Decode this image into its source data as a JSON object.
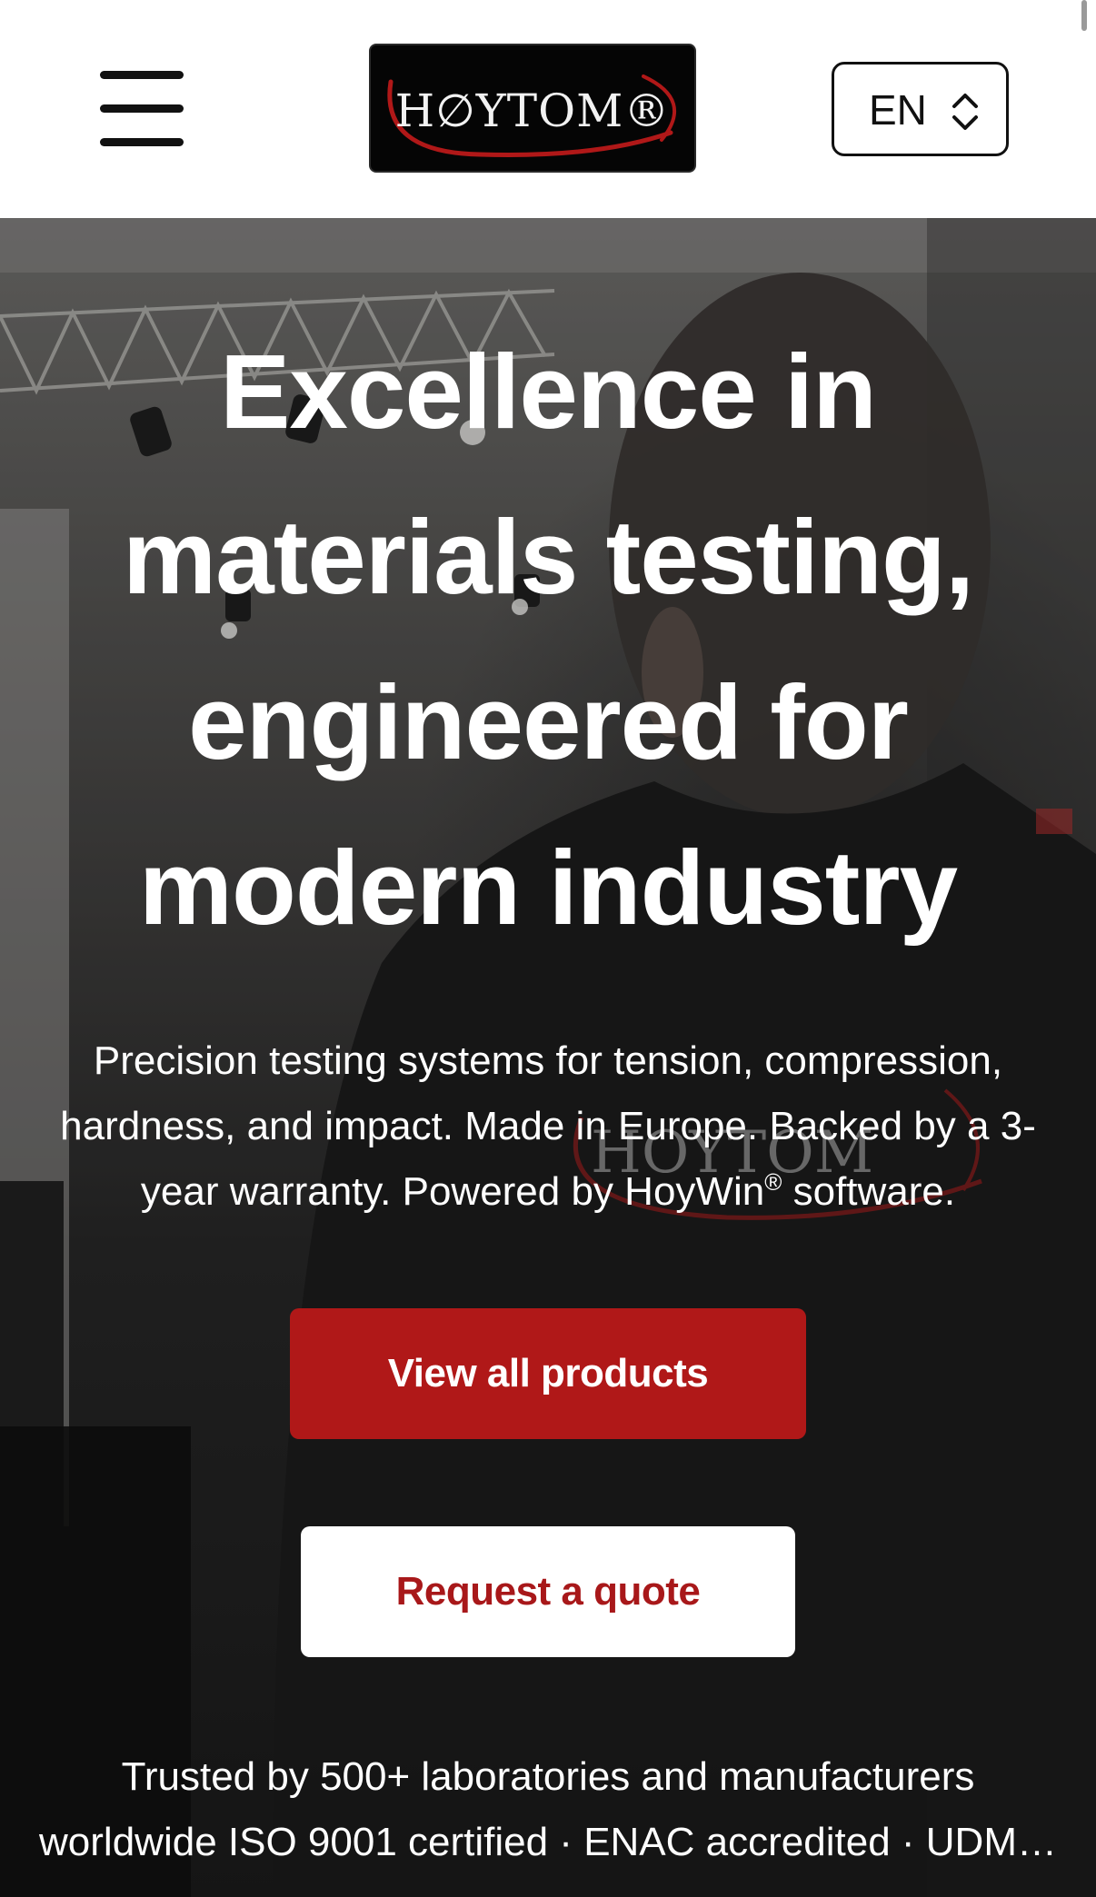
{
  "header": {
    "logo_text": "H∅YTOM®",
    "language": {
      "selected": "EN"
    }
  },
  "hero": {
    "title": "Excellence in materials testing, engineered for modern industry",
    "subtitle_main": "Precision testing systems for tension, compression, hardness, and impact. Made in Europe. Backed by a 3-year warranty. Powered by HoyWin",
    "subtitle_reg": "®",
    "subtitle_end": " software.",
    "primary_button": "View all products",
    "secondary_button": "Request a quote",
    "trust_text": "Trusted by 500+ laboratories and manufacturers worldwide ISO 9001 certified · ENAC accredited · UDM…"
  },
  "colors": {
    "accent": "#b01818",
    "accent_text": "#a8181a",
    "header_bg": "#ffffff",
    "hero_text": "#ffffff"
  },
  "icons": {
    "menu": "hamburger-menu-icon",
    "select": "chevron-up-down-icon"
  }
}
